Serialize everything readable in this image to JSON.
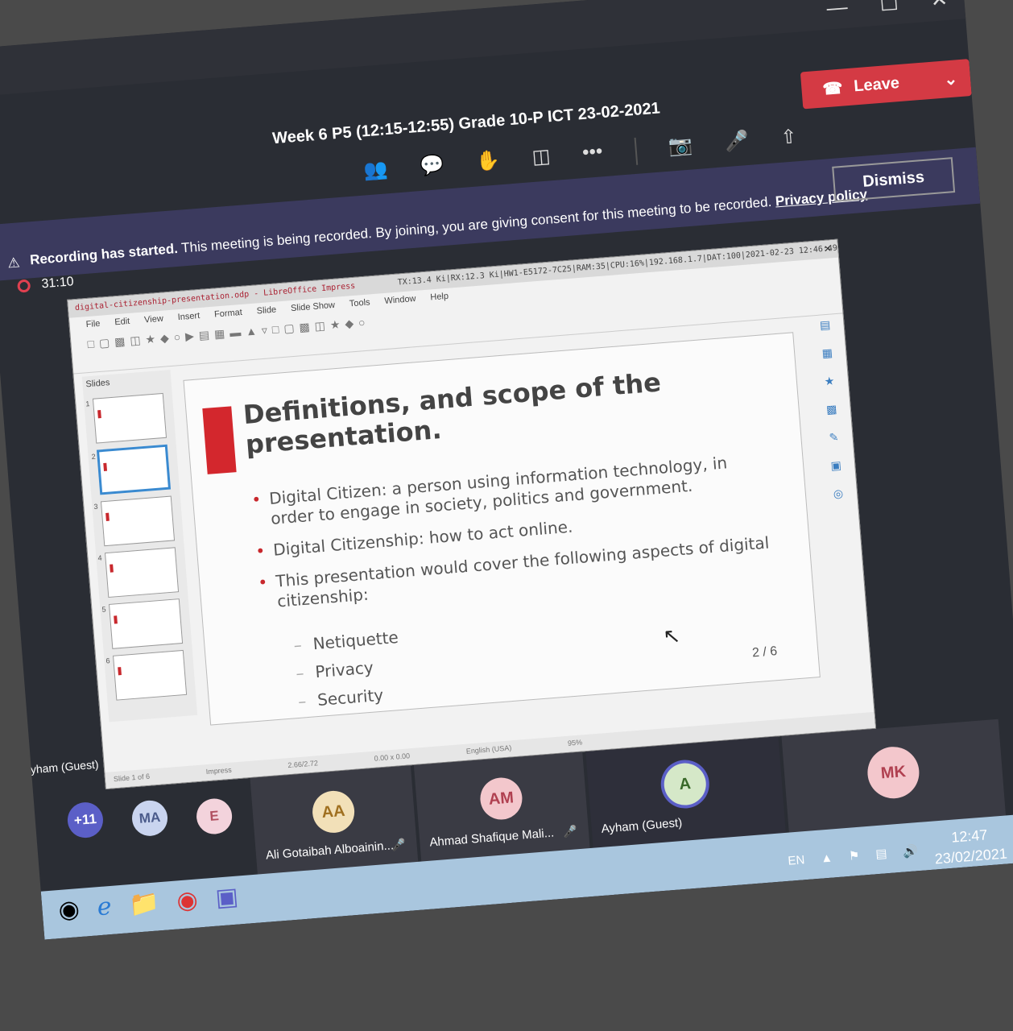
{
  "teams": {
    "meeting_title": "Week 6 P5 (12:15-12:55) Grade 10-P ICT 23-02-2021",
    "leave_label": "Leave",
    "dismiss_label": "Dismiss",
    "recording_bold": "Recording has started.",
    "recording_text": "This meeting is being recorded. By joining, you are giving consent for this meeting to be recorded.",
    "privacy_link": "Privacy policy",
    "timer": "31:10"
  },
  "libreoffice": {
    "window_title": "digital-citizenship-presentation.odp - LibreOffice Impress",
    "stats": "TX:13.4 Ki|RX:12.3 Ki|HW1-E5172-7C25|RAM:35|CPU:16%|192.168.1.7|DAT:100|2021-02-23 12:46:49",
    "menu": [
      "File",
      "Edit",
      "View",
      "Insert",
      "Format",
      "Slide",
      "Slide Show",
      "Tools",
      "Window",
      "Help"
    ],
    "slides_header": "Slides",
    "thumb_numbers": [
      "1",
      "2",
      "3",
      "4",
      "5",
      "6"
    ],
    "status": [
      "Slide 1 of 6",
      "Impress",
      "2.66/2.72",
      "0.00 x 0.00",
      "English (USA)",
      "95%"
    ]
  },
  "slide": {
    "title": "Definitions, and scope of the presentation.",
    "bullets": [
      "Digital Citizen: a person using information technology, in order to engage in society, politics and government.",
      "Digital Citizenship: how to act online.",
      "This presentation would cover the following aspects of digital citizenship:"
    ],
    "sub_bullets": [
      "Netiquette",
      "Privacy",
      "Security"
    ],
    "page_number": "2 / 6"
  },
  "participants": {
    "guest_label": "Ayham (Guest)",
    "mini": [
      {
        "initials": "+11",
        "color": "#5b5fc7",
        "text_color": "#ffffff"
      },
      {
        "initials": "MA",
        "color": "#c9d4ef",
        "text_color": "#4a5a8a"
      },
      {
        "initials": "E",
        "color": "#f3d3dc",
        "text_color": "#b05060"
      }
    ],
    "tiles": [
      {
        "initials": "AA",
        "name": "Ali Gotaibah Alboainin...",
        "color": "#f2e0b8",
        "text_color": "#a07020"
      },
      {
        "initials": "AM",
        "name": "Ahmad Shafique Mali...",
        "color": "#f3c7cc",
        "text_color": "#b04050"
      },
      {
        "initials": "A",
        "name": "Ayham (Guest)",
        "color": "#d5e8c8",
        "text_color": "#3a6a2a"
      },
      {
        "initials": "MK",
        "name": "",
        "color": "#f3c7cc",
        "text_color": "#b04050"
      }
    ]
  },
  "taskbar": {
    "language": "EN",
    "time": "12:47",
    "date": "23/02/2021"
  }
}
